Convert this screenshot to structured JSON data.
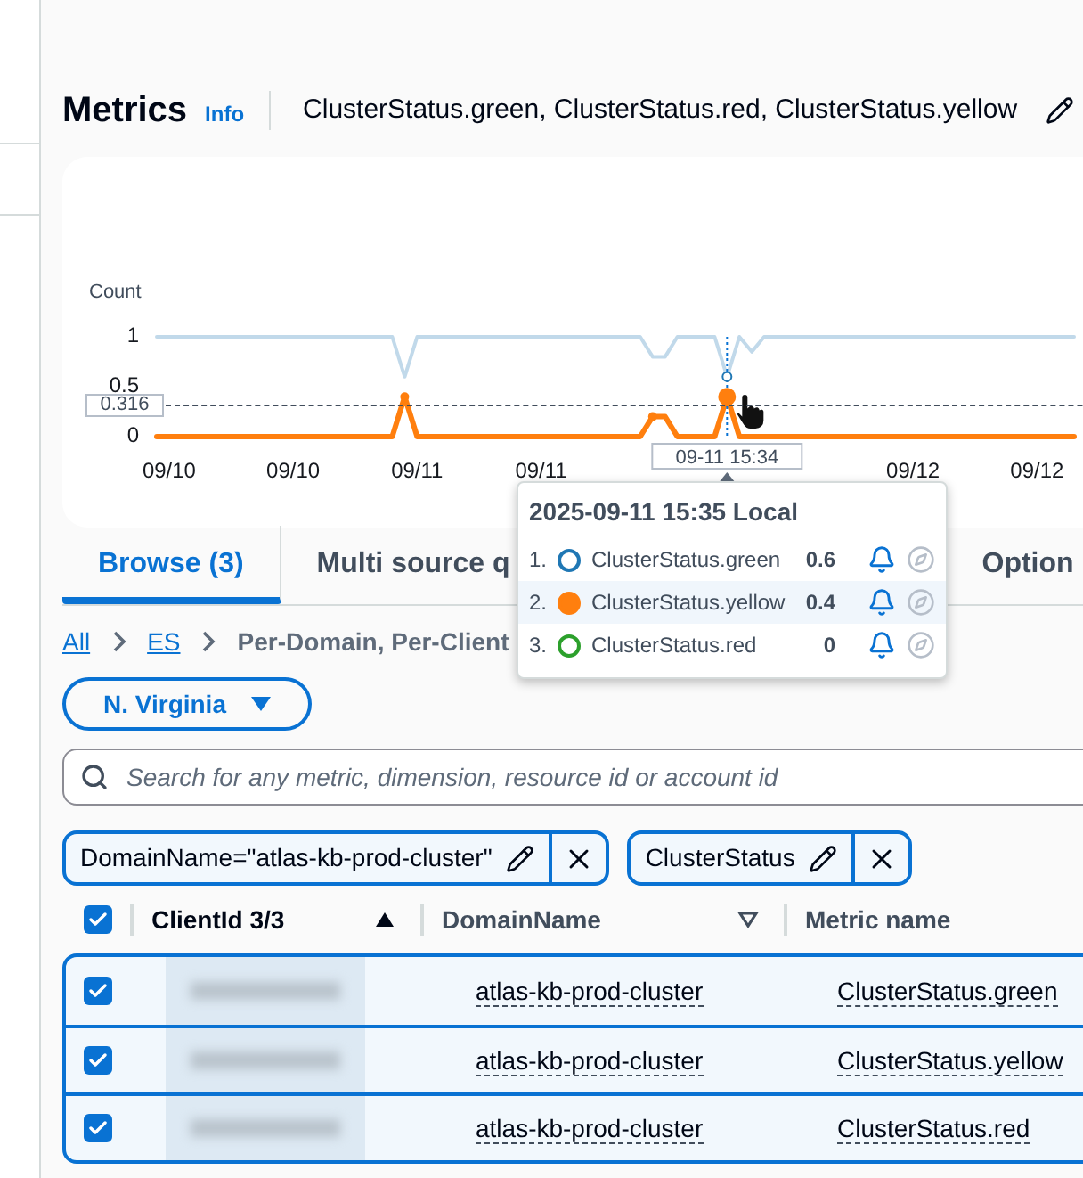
{
  "header": {
    "title": "Metrics",
    "info": "Info",
    "subtitle": "ClusterStatus.green, ClusterStatus.red, ClusterStatus.yellow"
  },
  "chart_data": {
    "type": "line",
    "ylabel": "Count",
    "ylim": [
      0,
      1
    ],
    "yticks": [
      0,
      0.5,
      1
    ],
    "categories": [
      null,
      "09/10",
      null,
      null,
      null,
      null,
      null,
      null,
      null,
      null,
      null,
      "09/10",
      null,
      null,
      null,
      null,
      null,
      null,
      null,
      null,
      null,
      "09/11",
      null,
      null,
      null,
      null,
      null,
      null,
      null,
      null,
      null,
      "09/11",
      null,
      null,
      null,
      null,
      null,
      null,
      null,
      null,
      null,
      null,
      null,
      null,
      null,
      null,
      null,
      null,
      null,
      null,
      null,
      null,
      null,
      null,
      null,
      null,
      null,
      null,
      null,
      null,
      null,
      "09/12",
      null,
      null,
      null,
      null,
      null,
      null,
      null,
      null,
      null,
      "09/12",
      null,
      null,
      null
    ],
    "series": [
      {
        "name": "ClusterStatus.green",
        "color": "#1f77b4",
        "values": [
          1,
          1,
          1,
          1,
          1,
          1,
          1,
          1,
          1,
          1,
          1,
          1,
          1,
          1,
          1,
          1,
          1,
          1,
          1,
          1,
          0.6,
          1,
          1,
          1,
          1,
          1,
          1,
          1,
          1,
          1,
          1,
          1,
          1,
          1,
          1,
          1,
          1,
          1,
          1,
          1,
          0.8,
          0.8,
          1,
          1,
          1,
          1,
          0.6,
          1,
          0.85,
          1,
          1,
          1,
          1,
          1,
          1,
          1,
          1,
          1,
          1,
          1,
          1,
          1,
          1,
          1,
          1,
          1,
          1,
          1,
          1,
          1,
          1,
          1,
          1,
          1,
          1
        ]
      },
      {
        "name": "ClusterStatus.yellow",
        "color": "#ff7f0e",
        "values": [
          0,
          0,
          0,
          0,
          0,
          0,
          0,
          0,
          0,
          0,
          0,
          0,
          0,
          0,
          0,
          0,
          0,
          0,
          0,
          0,
          0.4,
          0,
          0,
          0,
          0,
          0,
          0,
          0,
          0,
          0,
          0,
          0,
          0,
          0,
          0,
          0,
          0,
          0,
          0,
          0,
          0.2,
          0.2,
          0,
          0,
          0,
          0,
          0.4,
          0,
          0,
          0,
          0,
          0,
          0,
          0,
          0,
          0,
          0,
          0,
          0,
          0,
          0,
          0,
          0,
          0,
          0,
          0,
          0,
          0,
          0,
          0,
          0,
          0,
          0,
          0,
          0
        ]
      }
    ]
  },
  "crosshair": {
    "value_label": "0.316",
    "time_label": "09-11 15:34"
  },
  "tooltip": {
    "title": "2025-09-11 15:35 Local",
    "rows": [
      {
        "index": "1.",
        "value": "0.6",
        "selected": false
      },
      {
        "index": "2.",
        "value": "0.4",
        "selected": true
      },
      {
        "index": "3.",
        "name": "ClusterStatus.red",
        "color": "#2ca02c",
        "value": "0",
        "selected": false
      }
    ]
  },
  "tabs": [
    {
      "label": "Browse (3)",
      "selected": true
    },
    {
      "label": "Multi source q",
      "selected": false
    },
    {
      "label": "Option",
      "selected": false
    }
  ],
  "breadcrumb": [
    {
      "label": "All",
      "link": true
    },
    {
      "label": "ES",
      "link": true
    },
    {
      "label": "Per-Domain, Per-Client",
      "link": false
    }
  ],
  "region": "N. Virginia",
  "search": {
    "placeholder": "Search for any metric, dimension, resource id or account id"
  },
  "filters": [
    {
      "text": "DomainName=\"atlas-kb-prod-cluster\""
    },
    {
      "text": "ClusterStatus"
    }
  ],
  "table": {
    "all_checked": true,
    "columns": [
      {
        "label": "ClientId 3/3",
        "kind": "sorted"
      },
      {
        "label": "DomainName",
        "kind": "sortable"
      },
      {
        "label": "Metric name",
        "kind": "plain"
      }
    ],
    "rows": [
      {
        "checked": true,
        "client_redacted": true,
        "domain": "atlas-kb-prod-cluster",
        "metric": "ClusterStatus.green"
      },
      {
        "checked": true,
        "client_redacted": true,
        "domain": "atlas-kb-prod-cluster",
        "metric": "ClusterStatus.yellow"
      },
      {
        "checked": true,
        "client_redacted": true,
        "domain": "atlas-kb-prod-cluster",
        "metric": "ClusterStatus.red"
      }
    ]
  }
}
